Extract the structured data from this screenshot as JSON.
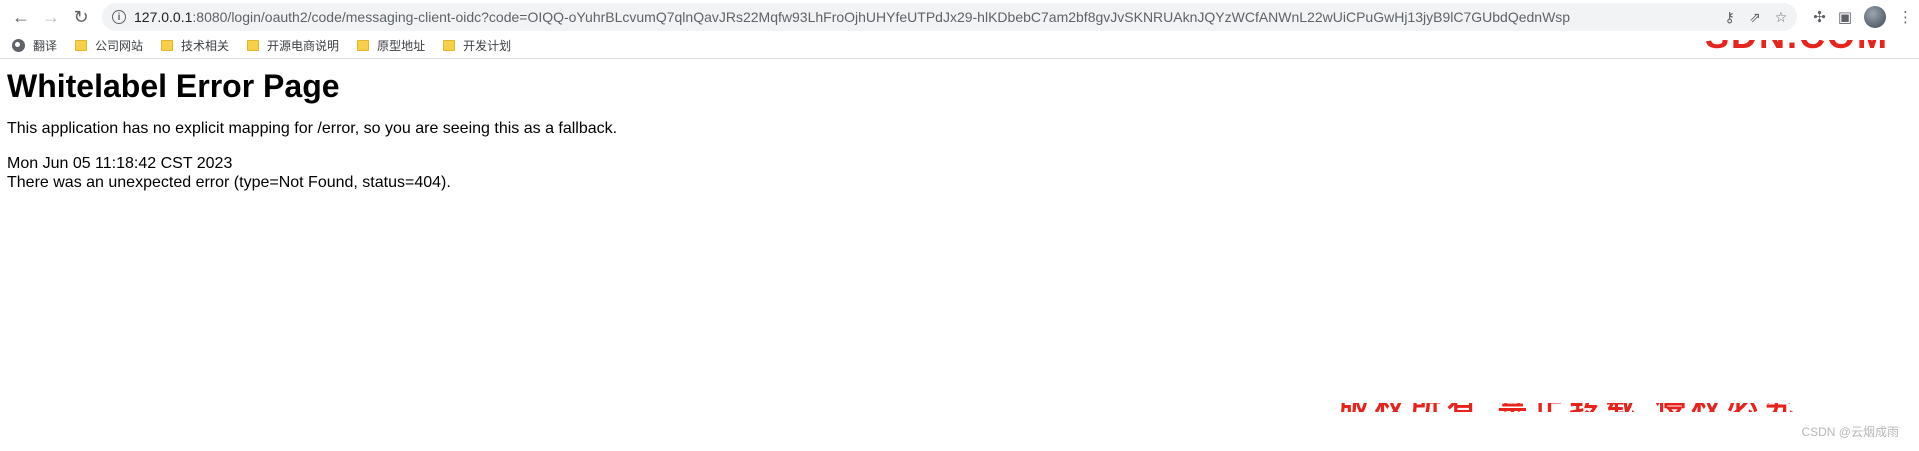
{
  "browser": {
    "nav": {
      "back_icon": "←",
      "forward_icon": "→",
      "reload_icon": "↻"
    },
    "omnibox": {
      "url_host": "127.0.0.1",
      "url_rest": ":8080/login/oauth2/code/messaging-client-oidc?code=OIQQ-oYuhrBLcvumQ7qlnQavJRs22Mqfw93LhFroOjhUHYfeUTPdJx29-hlKDbebC7am2bf8gvJvSKNRUAknJQYzWCfANWnL22wUiCPuGwHj13jyB9lC7GUbdQednWsp"
    },
    "bookmarks": [
      {
        "label": "翻译",
        "icon": "globe-icon"
      },
      {
        "label": "公司网站",
        "icon": "folder-icon"
      },
      {
        "label": "技术相关",
        "icon": "folder-icon"
      },
      {
        "label": "开源电商说明",
        "icon": "folder-icon"
      },
      {
        "label": "原型地址",
        "icon": "folder-icon"
      },
      {
        "label": "开发计划",
        "icon": "folder-icon"
      }
    ]
  },
  "page": {
    "title": "Whitelabel Error Page",
    "message": "This application has no explicit mapping for /error, so you are seeing this as a fallback.",
    "timestamp": "Mon Jun 05 11:18:42 CST 2023",
    "error": "There was an unexpected error (type=Not Found, status=404)."
  },
  "watermark": {
    "csdn": "CSDN @云烟成雨"
  },
  "colors": {
    "watermark_red": "#e8231c",
    "omnibox_bg": "#f1f3f4"
  }
}
